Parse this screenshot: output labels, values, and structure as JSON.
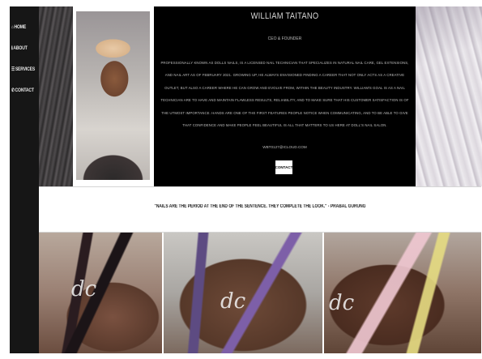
{
  "nav": {
    "items": [
      {
        "icon": "home-icon",
        "glyph": "⌂",
        "label": "HOME"
      },
      {
        "icon": "info-icon",
        "glyph": "ℹ",
        "label": "ABOUT"
      },
      {
        "icon": "services-icon",
        "glyph": "☰",
        "label": "SERVICES"
      },
      {
        "icon": "phone-icon",
        "glyph": "✆",
        "label": "CONTACT"
      }
    ]
  },
  "profile": {
    "name": "WILLIAM TAITANO",
    "role": "CEO & FOUNDER",
    "bio": "PROFESSIONALLY KNOWN AS DOLLS NAILS, IS A LICENSED NAIL TECHNICIAN THAT SPECIALIZES IN NATURAL NAIL CARE, GEL EXTENSIONS, AND NAIL ART AS OF FEBRUARY 2021. GROWING UP, HE ALWAYS ENVISIONED FINDING A CAREER THAT NOT ONLY ACTS AS A CREATIVE OUTLET, BUT ALSO A CAREER WHERE HE CAN GROW AND EVOLVE FROM, WITHIN THE BEAUTY INDUSTRY. WILLIAM'S GOAL IS AS A NAIL TECHNICIAN ARE TO HAVE AND MAINTAIN FLAWLESS RESULTS, RELIABILITY, AND TO MAKE SURE THAT HIS CUSTOMER SATISFACTION IS OF THE UTMOST IMPORTANCE. HANDS ARE ONE OF THE FIRST FEATURES PEOPLE NOTICE WHEN COMMUNICATING, AND TO BE ABLE TO GIVE THAT CONFIDENCE AND MAKE PEOPLE FEEL BEAUTIFUL IS ALL THAT MATTERS TO US HERE AT DOLL'S NAIL SALON.",
    "email": "WBT0127@ICLOUD.COM",
    "contact_label": "CONTACT"
  },
  "quote": "\"NAILS ARE THE PERIOD AT THE END OF THE SENTENCE. THEY COMPLETE THE LOOK.\" - PRABAL GURUNG",
  "gallery": [
    {
      "watermark": "dc"
    },
    {
      "watermark": "dc"
    },
    {
      "watermark": "dc"
    }
  ],
  "colors": {
    "sidebar": "#161616",
    "panel": "#000000",
    "panel_text": "#cfcfcf"
  }
}
